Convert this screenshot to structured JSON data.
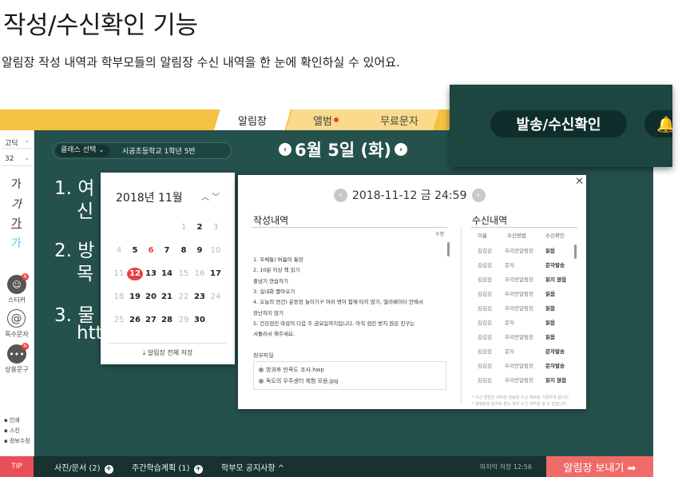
{
  "page": {
    "title": "작성/수신확인 기능",
    "subtitle": "알림장 작성 내역과 학부모들의 알림장 수신 내역을 한 눈에 확인하실 수 있어요."
  },
  "topbar": {
    "tabs": [
      {
        "label": "알림장",
        "active": true
      },
      {
        "label": "앨범",
        "badge": true
      },
      {
        "label": "무료문자"
      }
    ]
  },
  "toolbar": {
    "font_family": "고딕",
    "font_size": "32",
    "glyph": "가",
    "tools": [
      {
        "label": "스티커",
        "icon": "sticker-icon",
        "badge": "N"
      },
      {
        "label": "특수문자",
        "icon": "at-sign-icon"
      },
      {
        "label": "상용문구",
        "icon": "chat-bubble-icon",
        "badge": "N"
      }
    ],
    "options": [
      "인쇄",
      "스킨",
      "정보수정"
    ]
  },
  "editor": {
    "class_select": "클래스 선택",
    "class_name": "시공초등학교 1학년 5반",
    "date": "6월 5일 (화)",
    "lines": [
      {
        "number": "1.",
        "text": "여",
        "cont": "신"
      },
      {
        "number": "2.",
        "text": "방",
        "cont": "목"
      },
      {
        "number": "3.",
        "text": "물",
        "cont": "htt"
      }
    ]
  },
  "calendar": {
    "month": "2018년 11월",
    "weeks": [
      [
        {
          "d": "",
          "t": ""
        },
        {
          "d": "",
          "t": ""
        },
        {
          "d": "",
          "t": ""
        },
        {
          "d": "",
          "t": ""
        },
        {
          "d": "1",
          "t": "g"
        },
        {
          "d": "2",
          "t": ""
        },
        {
          "d": "3",
          "t": "g"
        }
      ],
      [
        {
          "d": "4",
          "t": "g"
        },
        {
          "d": "5",
          "t": ""
        },
        {
          "d": "6",
          "t": "r"
        },
        {
          "d": "7",
          "t": ""
        },
        {
          "d": "8",
          "t": ""
        },
        {
          "d": "9",
          "t": ""
        },
        {
          "d": "10",
          "t": "g"
        }
      ],
      [
        {
          "d": "11",
          "t": "g"
        },
        {
          "d": "12",
          "t": "sel"
        },
        {
          "d": "13",
          "t": ""
        },
        {
          "d": "14",
          "t": ""
        },
        {
          "d": "15",
          "t": "g"
        },
        {
          "d": "16",
          "t": "g"
        },
        {
          "d": "17",
          "t": ""
        }
      ],
      [
        {
          "d": "18",
          "t": "g"
        },
        {
          "d": "19",
          "t": ""
        },
        {
          "d": "20",
          "t": ""
        },
        {
          "d": "21",
          "t": ""
        },
        {
          "d": "22",
          "t": "g"
        },
        {
          "d": "23",
          "t": ""
        },
        {
          "d": "24",
          "t": "g"
        }
      ],
      [
        {
          "d": "25",
          "t": "g"
        },
        {
          "d": "26",
          "t": ""
        },
        {
          "d": "27",
          "t": ""
        },
        {
          "d": "28",
          "t": ""
        },
        {
          "d": "29",
          "t": "g"
        },
        {
          "d": "30",
          "t": ""
        },
        {
          "d": "",
          "t": ""
        }
      ]
    ],
    "save_all": "알림장 전체 저장"
  },
  "receipt": {
    "date": "2018-11-12 금 24:59",
    "written_title": "작성내역",
    "edit_label": "수정",
    "written_lines": [
      "1. 우체통) 버름이 통장",
      "2. 10분 이상 책 읽기",
      "줄넘기 연습하기",
      "3. 실내화 빨아오기",
      "4. 오늘의 연건) 운동장 놀이기구 여러 명이 함께 타지 않기, 엘리베이터 안에서",
      "장난하지 않기",
      "5. 건강검진 마감이 다음 주 금요일까지입니다. 아직 검진 받지 않은 친구는",
      "서둘러서 해주세요."
    ],
    "attach_label": "첨부파일",
    "attachments": [
      "방과후 만족도 조사.hwp",
      "독도의 우주센터 체험 모음.jpg"
    ],
    "received_title": "수신내역",
    "columns": [
      "이름",
      "수신방법",
      "수신확인"
    ],
    "rows": [
      {
        "name": "김김김",
        "method": "우리반알림장",
        "status": "읽음"
      },
      {
        "name": "김김김",
        "method": "문자",
        "status": "문자발송"
      },
      {
        "name": "김김김",
        "method": "우리반알림장",
        "status": "읽지 않음"
      },
      {
        "name": "김김김",
        "method": "우리반알림장",
        "status": "읽음"
      },
      {
        "name": "김김김",
        "method": "우리반알림장",
        "status": "읽음"
      },
      {
        "name": "김김김",
        "method": "문자",
        "status": "읽음"
      },
      {
        "name": "김김김",
        "method": "우리반알림장",
        "status": "읽음"
      },
      {
        "name": "김김김",
        "method": "문자",
        "status": "문자발송"
      },
      {
        "name": "김김김",
        "method": "우리반알림장",
        "status": "문자발송"
      },
      {
        "name": "김김김",
        "method": "우리반알림장",
        "status": "읽지 않음"
      }
    ],
    "notes": [
      "* 수신 방법은 어떠한 알림장 수신 여부를 기록하게 됩니다.",
      "* 알림장을 문자로 받는 경우 수신 여부를 알 수 없습니다."
    ]
  },
  "bottombar": {
    "tip": "TIP",
    "items": [
      {
        "label": "사진/문서 (2)",
        "suffix": "+"
      },
      {
        "label": "주간학습계획 (1)",
        "suffix": "+"
      },
      {
        "label": "학부모 공지사항",
        "suffix": "^"
      }
    ],
    "last_saved": "마지막 저장 12:56",
    "send": "알림장 보내기 ➡"
  },
  "overlay": {
    "button": "발송/수신확인",
    "icon": "bell-icon"
  },
  "colors": {
    "app_bg": "#25514d",
    "topbar": "#f5c143",
    "accent_red": "#e84040",
    "send_button": "#f06a68"
  }
}
